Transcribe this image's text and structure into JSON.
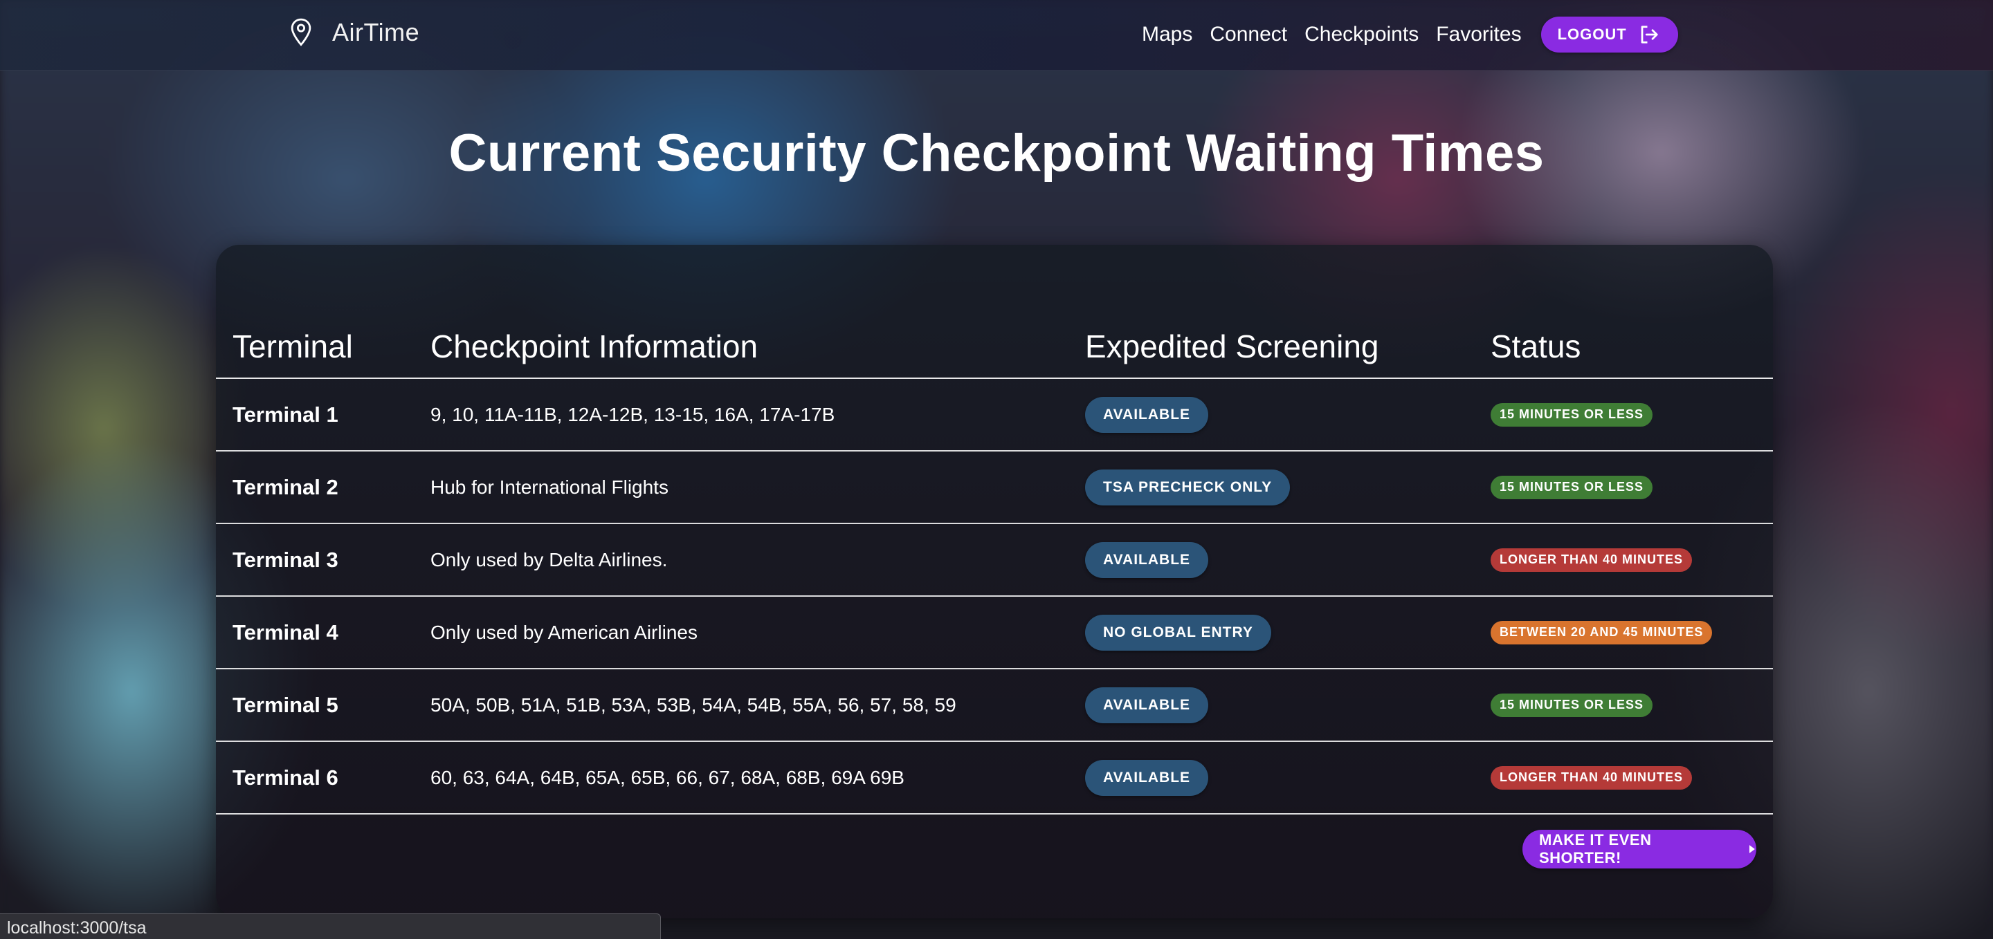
{
  "header": {
    "brand": "AirTime",
    "nav_links": [
      "Maps",
      "Connect",
      "Checkpoints",
      "Favorites"
    ],
    "logout_label": "LOGOUT"
  },
  "page_title": "Current Security Checkpoint Waiting Times",
  "table": {
    "columns": [
      "Terminal",
      "Checkpoint Information",
      "Expedited Screening",
      "Status"
    ],
    "rows": [
      {
        "terminal": "Terminal 1",
        "info": "9, 10, 11A-11B, 12A-12B, 13-15, 16A, 17A-17B",
        "expedited": "AVAILABLE",
        "status": "15 MINUTES OR LESS",
        "status_color": "#3f7d35"
      },
      {
        "terminal": "Terminal 2",
        "info": "Hub for International Flights",
        "expedited": "TSA PRECHECK ONLY",
        "status": "15 MINUTES OR LESS",
        "status_color": "#3f7d35"
      },
      {
        "terminal": "Terminal 3",
        "info": "Only used by Delta Airlines.",
        "expedited": "AVAILABLE",
        "status": "LONGER THAN 40 MINUTES",
        "status_color": "#b53a38"
      },
      {
        "terminal": "Terminal 4",
        "info": "Only used by American Airlines",
        "expedited": "NO GLOBAL ENTRY",
        "status": "BETWEEN 20 AND 45 MINUTES",
        "status_color": "#d9742e"
      },
      {
        "terminal": "Terminal 5",
        "info": "50A, 50B, 51A, 51B, 53A, 53B, 54A, 54B, 55A, 56, 57, 58, 59",
        "expedited": "AVAILABLE",
        "status": "15 MINUTES OR LESS",
        "status_color": "#3f7d35"
      },
      {
        "terminal": "Terminal 6",
        "info": "60, 63, 64A, 64B, 65A, 65B, 66, 67, 68A, 68B, 69A 69B",
        "expedited": "AVAILABLE",
        "status": "LONGER THAN 40 MINUTES",
        "status_color": "#b53a38"
      }
    ]
  },
  "cta_label": "MAKE IT EVEN SHORTER!",
  "status_bar_url": "localhost:3000/tsa",
  "colors": {
    "accent": "#8a2be2",
    "expedited_pill": "#2b5478"
  },
  "icons": {
    "brand": "location-pin-icon",
    "logout": "logout-icon",
    "cta": "caret-right-icon"
  }
}
